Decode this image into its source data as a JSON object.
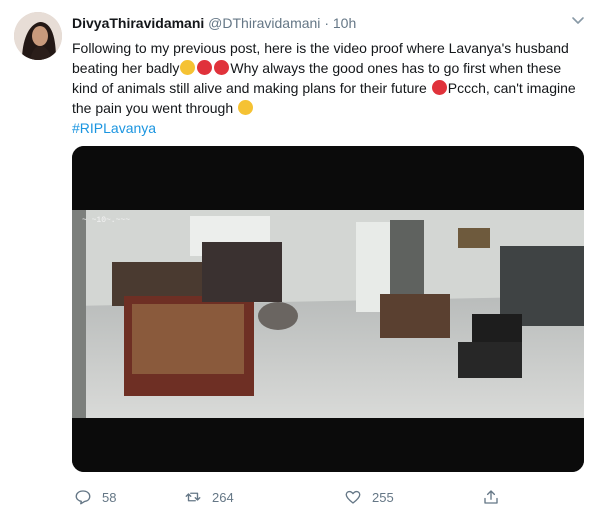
{
  "tweet": {
    "display_name": "DivyaThiravidamani",
    "handle": "@DThiravidamani",
    "separator": "·",
    "time": "10h",
    "text_part1": "Following to my previous post, here is the video proof where Lavanya's husband beating her badly",
    "text_part2": "Why always the good ones has to go first when these kind of animals still alive and making plans for their future",
    "text_part3": "Pccch, can't imagine the pain you went through",
    "hashtag": "#RIPLavanya",
    "media_overlay_text": "~ ~10~.~~~"
  },
  "actions": {
    "replies": "58",
    "retweets": "264",
    "likes": "255"
  },
  "icons": {
    "reply": "reply-icon",
    "retweet": "retweet-icon",
    "like": "heart-icon",
    "share": "share-icon",
    "menu": "chevron-down-icon"
  },
  "colors": {
    "link": "#1b95e0",
    "muted": "#657786",
    "text": "#14171a"
  }
}
